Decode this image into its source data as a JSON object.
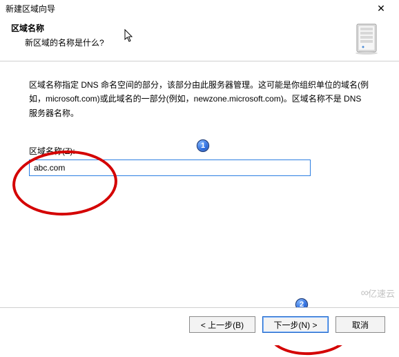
{
  "window": {
    "title": "新建区域向导",
    "close_glyph": "✕"
  },
  "header": {
    "heading": "区域名称",
    "sub": "新区域的名称是什么?"
  },
  "description": "区域名称指定 DNS 命名空间的部分，该部分由此服务器管理。这可能是你组织单位的域名(例如，microsoft.com)或此域名的一部分(例如，newzone.microsoft.com)。区域名称不是 DNS 服务器名称。",
  "field": {
    "label": "区域名称(Z):",
    "value": "abc.com"
  },
  "buttons": {
    "back": "< 上一步(B)",
    "next": "下一步(N) >",
    "cancel": "取消"
  },
  "annotations": {
    "badge1": "1",
    "badge2": "2"
  },
  "watermark": {
    "text": "亿速云",
    "glyph": "∞"
  }
}
